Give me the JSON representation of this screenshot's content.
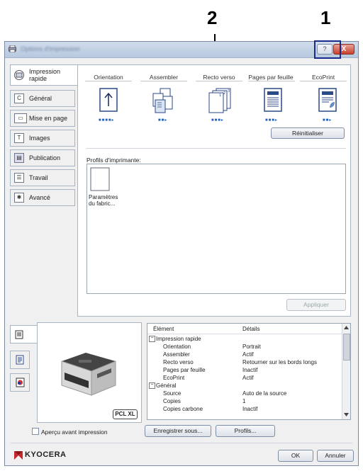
{
  "callouts": {
    "one": "1",
    "two": "2"
  },
  "titlebar": {
    "title": "Options d'impression",
    "help_label": "?",
    "close_label": "X"
  },
  "sidebar": {
    "items": [
      {
        "label": "Impression rapide",
        "icon": "quick-print-icon"
      },
      {
        "label": "Général",
        "icon": "general-icon"
      },
      {
        "label": "Mise en page",
        "icon": "layout-icon"
      },
      {
        "label": "Images",
        "icon": "images-icon"
      },
      {
        "label": "Publication",
        "icon": "publishing-icon"
      },
      {
        "label": "Travail",
        "icon": "job-icon"
      },
      {
        "label": "Avancé",
        "icon": "advanced-icon"
      }
    ]
  },
  "main": {
    "options": [
      {
        "label": "Orientation"
      },
      {
        "label": "Assembler"
      },
      {
        "label": "Recto verso"
      },
      {
        "label": "Pages par feuille"
      },
      {
        "label": "EcoPrint"
      }
    ],
    "reset_label": "Réinitialiser",
    "profiles_label": "Profils d'imprimante:",
    "profile_item": "Paramètres du fabric...",
    "apply_label": "Appliquer"
  },
  "details": {
    "col_element": "Élément",
    "col_details": "Détails",
    "rows": [
      {
        "kind": "group",
        "label": "Impression rapide",
        "value": ""
      },
      {
        "kind": "item",
        "label": "Orientation",
        "value": "Portrait"
      },
      {
        "kind": "item",
        "label": "Assembler",
        "value": "Actif"
      },
      {
        "kind": "item",
        "label": "Recto verso",
        "value": "Retourner sur les bords longs"
      },
      {
        "kind": "item",
        "label": "Pages par feuille",
        "value": "Inactif"
      },
      {
        "kind": "item",
        "label": "EcoPrint",
        "value": "Actif"
      },
      {
        "kind": "group",
        "label": "Général",
        "value": ""
      },
      {
        "kind": "item",
        "label": "Source",
        "value": "Auto de la source"
      },
      {
        "kind": "item",
        "label": "Copies",
        "value": "1"
      },
      {
        "kind": "item",
        "label": "Copies carbone",
        "value": "Inactif"
      }
    ]
  },
  "preview": {
    "badge": "PCL XL"
  },
  "footer": {
    "preview_checkbox_label": "Aperçu avant impression",
    "save_as_label": "Enregistrer sous...",
    "profiles_label": "Profils...",
    "brand": "KYOCERA",
    "ok_label": "OK",
    "cancel_label": "Annuler"
  },
  "colors": {
    "accent": "#1a2a8c",
    "brand_red": "#c8262c"
  }
}
